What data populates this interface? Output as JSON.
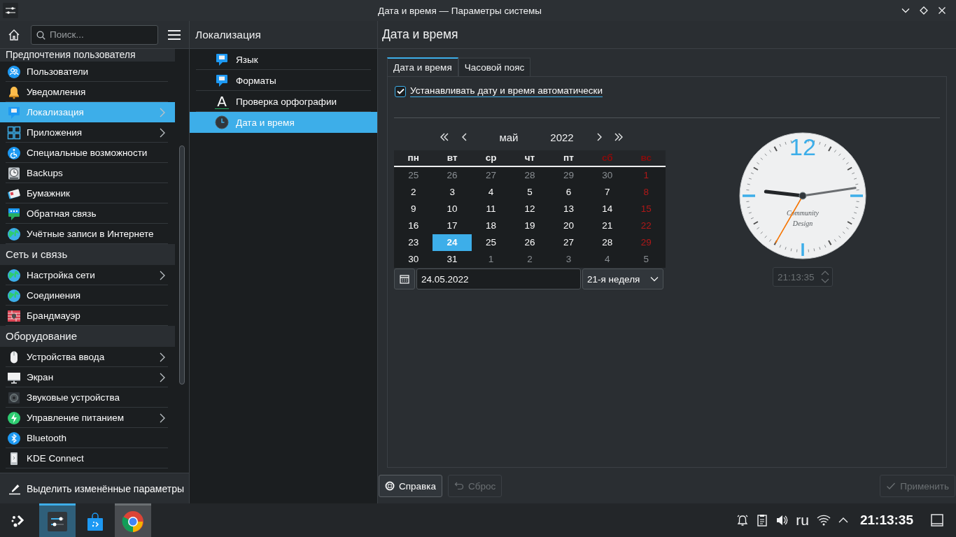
{
  "window": {
    "title": "Дата и время — Параметры системы"
  },
  "sidebar": {
    "search": {
      "placeholder": "Поиск..."
    },
    "groups": [
      {
        "title": "Предпочтения пользователя",
        "items": [
          {
            "label": "Пользователи",
            "selected": false,
            "expandable": false
          },
          {
            "label": "Уведомления",
            "selected": false,
            "expandable": false
          },
          {
            "label": "Локализация",
            "selected": true,
            "expandable": true
          },
          {
            "label": "Приложения",
            "selected": false,
            "expandable": true
          },
          {
            "label": "Специальные возможности",
            "selected": false,
            "expandable": false
          },
          {
            "label": "Backups",
            "selected": false,
            "expandable": false
          },
          {
            "label": "Бумажник",
            "selected": false,
            "expandable": false
          },
          {
            "label": "Обратная связь",
            "selected": false,
            "expandable": false
          },
          {
            "label": "Учётные записи в Интернете",
            "selected": false,
            "expandable": false
          }
        ]
      },
      {
        "title": "Сеть и связь",
        "items": [
          {
            "label": "Настройка сети",
            "selected": false,
            "expandable": true
          },
          {
            "label": "Соединения",
            "selected": false,
            "expandable": false
          },
          {
            "label": "Брандмауэр",
            "selected": false,
            "expandable": false
          }
        ]
      },
      {
        "title": "Оборудование",
        "items": [
          {
            "label": "Устройства ввода",
            "selected": false,
            "expandable": true
          },
          {
            "label": "Экран",
            "selected": false,
            "expandable": true
          },
          {
            "label": "Звуковые устройства",
            "selected": false,
            "expandable": false
          },
          {
            "label": "Управление питанием",
            "selected": false,
            "expandable": true
          },
          {
            "label": "Bluetooth",
            "selected": false,
            "expandable": false
          },
          {
            "label": "KDE Connect",
            "selected": false,
            "expandable": false
          }
        ]
      }
    ],
    "footer": "Выделить изменённые параметры"
  },
  "subpage": {
    "title": "Локализация",
    "items": [
      {
        "label": "Язык",
        "selected": false
      },
      {
        "label": "Форматы",
        "selected": false
      },
      {
        "label": "Проверка орфографии",
        "selected": false,
        "glyph": "A"
      },
      {
        "label": "Дата и время",
        "selected": true
      }
    ]
  },
  "page": {
    "title": "Дата и время",
    "tabs": [
      {
        "label": "Дата и время",
        "selected": true
      },
      {
        "label": "Часовой пояс",
        "selected": false
      }
    ],
    "auto_checkbox": {
      "label": "Устанавливать дату и время автоматически",
      "checked": true,
      "focused": true
    },
    "calendar": {
      "month": "май",
      "year": "2022",
      "weekdays": [
        {
          "label": "пн",
          "weekend": false
        },
        {
          "label": "вт",
          "weekend": false
        },
        {
          "label": "ср",
          "weekend": false
        },
        {
          "label": "чт",
          "weekend": false
        },
        {
          "label": "пт",
          "weekend": false
        },
        {
          "label": "сб",
          "weekend": true
        },
        {
          "label": "вс",
          "weekend": true
        }
      ],
      "weeks": [
        [
          {
            "day": "25",
            "other_month": true,
            "selected": false,
            "holiday": false
          },
          {
            "day": "26",
            "other_month": true,
            "selected": false,
            "holiday": false
          },
          {
            "day": "27",
            "other_month": true,
            "selected": false,
            "holiday": false
          },
          {
            "day": "28",
            "other_month": true,
            "selected": false,
            "holiday": false
          },
          {
            "day": "29",
            "other_month": true,
            "selected": false,
            "holiday": false
          },
          {
            "day": "30",
            "other_month": true,
            "selected": false,
            "holiday": false
          },
          {
            "day": "1",
            "other_month": false,
            "selected": false,
            "holiday": true
          }
        ],
        [
          {
            "day": "2",
            "other_month": false,
            "selected": false,
            "holiday": false
          },
          {
            "day": "3",
            "other_month": false,
            "selected": false,
            "holiday": false
          },
          {
            "day": "4",
            "other_month": false,
            "selected": false,
            "holiday": false
          },
          {
            "day": "5",
            "other_month": false,
            "selected": false,
            "holiday": false
          },
          {
            "day": "6",
            "other_month": false,
            "selected": false,
            "holiday": false
          },
          {
            "day": "7",
            "other_month": false,
            "selected": false,
            "holiday": false
          },
          {
            "day": "8",
            "other_month": false,
            "selected": false,
            "holiday": true
          }
        ],
        [
          {
            "day": "9",
            "other_month": false,
            "selected": false,
            "holiday": false
          },
          {
            "day": "10",
            "other_month": false,
            "selected": false,
            "holiday": false
          },
          {
            "day": "11",
            "other_month": false,
            "selected": false,
            "holiday": false
          },
          {
            "day": "12",
            "other_month": false,
            "selected": false,
            "holiday": false
          },
          {
            "day": "13",
            "other_month": false,
            "selected": false,
            "holiday": false
          },
          {
            "day": "14",
            "other_month": false,
            "selected": false,
            "holiday": false
          },
          {
            "day": "15",
            "other_month": false,
            "selected": false,
            "holiday": true
          }
        ],
        [
          {
            "day": "16",
            "other_month": false,
            "selected": false,
            "holiday": false
          },
          {
            "day": "17",
            "other_month": false,
            "selected": false,
            "holiday": false
          },
          {
            "day": "18",
            "other_month": false,
            "selected": false,
            "holiday": false
          },
          {
            "day": "19",
            "other_month": false,
            "selected": false,
            "holiday": false
          },
          {
            "day": "20",
            "other_month": false,
            "selected": false,
            "holiday": false
          },
          {
            "day": "21",
            "other_month": false,
            "selected": false,
            "holiday": false
          },
          {
            "day": "22",
            "other_month": false,
            "selected": false,
            "holiday": true
          }
        ],
        [
          {
            "day": "23",
            "other_month": false,
            "selected": false,
            "holiday": false
          },
          {
            "day": "24",
            "other_month": false,
            "selected": true,
            "holiday": false
          },
          {
            "day": "25",
            "other_month": false,
            "selected": false,
            "holiday": false
          },
          {
            "day": "26",
            "other_month": false,
            "selected": false,
            "holiday": false
          },
          {
            "day": "27",
            "other_month": false,
            "selected": false,
            "holiday": false
          },
          {
            "day": "28",
            "other_month": false,
            "selected": false,
            "holiday": false
          },
          {
            "day": "29",
            "other_month": false,
            "selected": false,
            "holiday": true
          }
        ],
        [
          {
            "day": "30",
            "other_month": false,
            "selected": false,
            "holiday": false
          },
          {
            "day": "31",
            "other_month": false,
            "selected": false,
            "holiday": false
          },
          {
            "day": "1",
            "other_month": true,
            "selected": false,
            "holiday": false
          },
          {
            "day": "2",
            "other_month": true,
            "selected": false,
            "holiday": false
          },
          {
            "day": "3",
            "other_month": true,
            "selected": false,
            "holiday": false
          },
          {
            "day": "4",
            "other_month": true,
            "selected": false,
            "holiday": false
          },
          {
            "day": "5",
            "other_month": true,
            "selected": false,
            "holiday": false
          }
        ]
      ],
      "date": "24.05.2022",
      "week": "21-я неделя"
    },
    "clock": {
      "numeral": "12",
      "brand": [
        "Community",
        "Design"
      ],
      "time": "21:13:35",
      "time_disabled": true
    }
  },
  "buttons": [
    {
      "label": "Справка",
      "disabled": false
    },
    {
      "label": "Сброс",
      "disabled": true
    },
    {
      "label": "Применить",
      "disabled": true
    }
  ],
  "taskbar": {
    "tasks": [
      {
        "active": true,
        "hovered": false
      },
      {
        "active": false,
        "hovered": false
      },
      {
        "active": false,
        "hovered": true
      }
    ],
    "layout": "ru",
    "clock": "21:13:35"
  }
}
